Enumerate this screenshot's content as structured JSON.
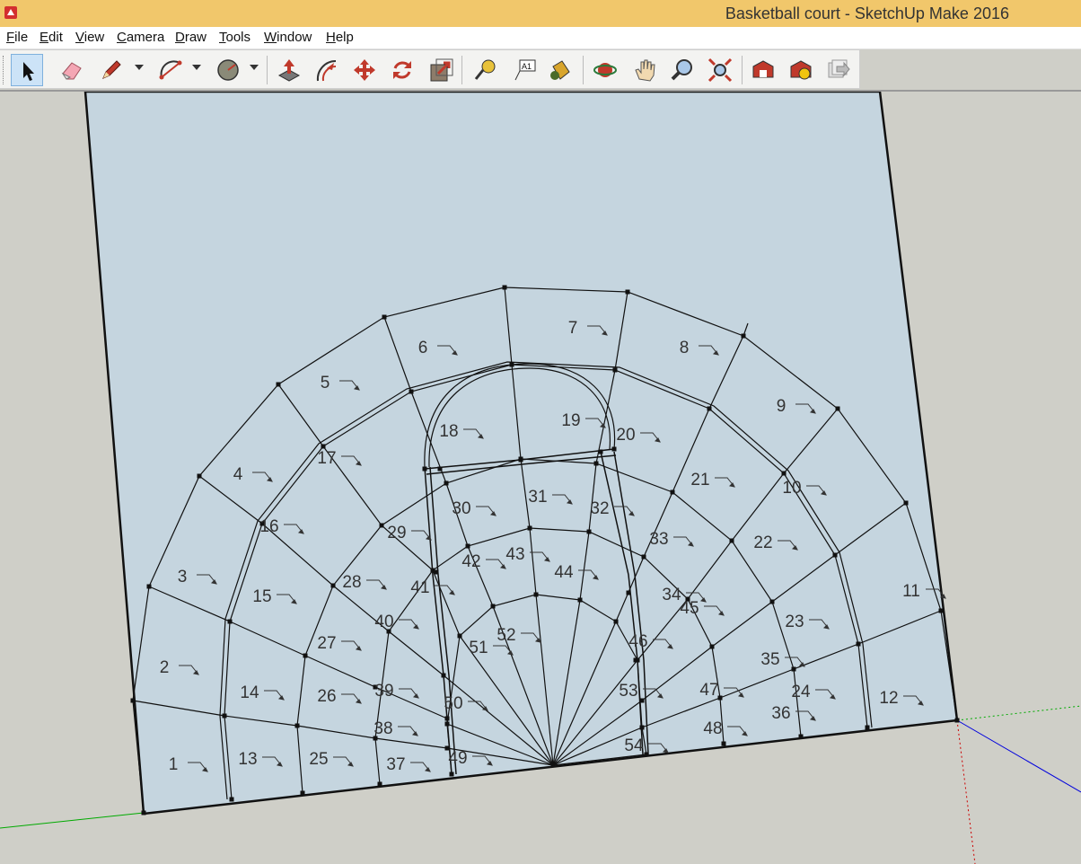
{
  "window": {
    "title": "Basketball court - SketchUp Make 2016"
  },
  "menu": [
    {
      "label": "File",
      "key": "F",
      "rest": "ile"
    },
    {
      "label": "Edit",
      "key": "E",
      "rest": "dit"
    },
    {
      "label": "View",
      "key": "V",
      "rest": "iew"
    },
    {
      "label": "Camera",
      "key": "C",
      "rest": "amera"
    },
    {
      "label": "Draw",
      "key": "D",
      "rest": "raw"
    },
    {
      "label": "Tools",
      "key": "T",
      "rest": "ools"
    },
    {
      "label": "Window",
      "key": "W",
      "rest": "indow"
    },
    {
      "label": "Help",
      "key": "H",
      "rest": "elp"
    }
  ],
  "toolbar": [
    {
      "icon": "select-arrow-icon",
      "active": true
    },
    {
      "icon": "eraser-icon"
    },
    {
      "icon": "pencil-line-icon",
      "dropdown": true
    },
    {
      "icon": "arc-icon",
      "dropdown": true
    },
    {
      "icon": "circle-shape-icon",
      "dropdown": true
    },
    {
      "icon": "push-pull-icon"
    },
    {
      "icon": "offset-icon"
    },
    {
      "icon": "move-icon"
    },
    {
      "icon": "rotate-icon"
    },
    {
      "icon": "scale-icon"
    },
    {
      "icon": "tape-measure-icon"
    },
    {
      "icon": "text-label-icon",
      "text": "A1"
    },
    {
      "icon": "paint-bucket-icon"
    },
    {
      "icon": "orbit-icon"
    },
    {
      "icon": "pan-hand-icon"
    },
    {
      "icon": "zoom-icon"
    },
    {
      "icon": "zoom-extents-icon"
    },
    {
      "icon": "warehouse-icon"
    },
    {
      "icon": "extension-warehouse-icon"
    },
    {
      "icon": "send-to-layout-icon"
    }
  ],
  "model": {
    "region_labels": [
      "1",
      "2",
      "3",
      "4",
      "5",
      "6",
      "7",
      "8",
      "9",
      "10",
      "11",
      "12",
      "13",
      "14",
      "15",
      "16",
      "17",
      "18",
      "19",
      "20",
      "21",
      "22",
      "23",
      "24",
      "25",
      "26",
      "27",
      "28",
      "29",
      "30",
      "31",
      "32",
      "33",
      "34",
      "35",
      "36",
      "37",
      "38",
      "39",
      "40",
      "41",
      "42",
      "43",
      "44",
      "45",
      "46",
      "47",
      "48",
      "49",
      "50",
      "51",
      "52",
      "53",
      "54"
    ]
  },
  "colors": {
    "titlebar": "#f1c76b",
    "face": "#c5d5df",
    "background": "#cfcfc8",
    "edge": "#111111",
    "axis_red": "#cc0000",
    "axis_green": "#00aa00",
    "axis_blue": "#0000dd"
  }
}
